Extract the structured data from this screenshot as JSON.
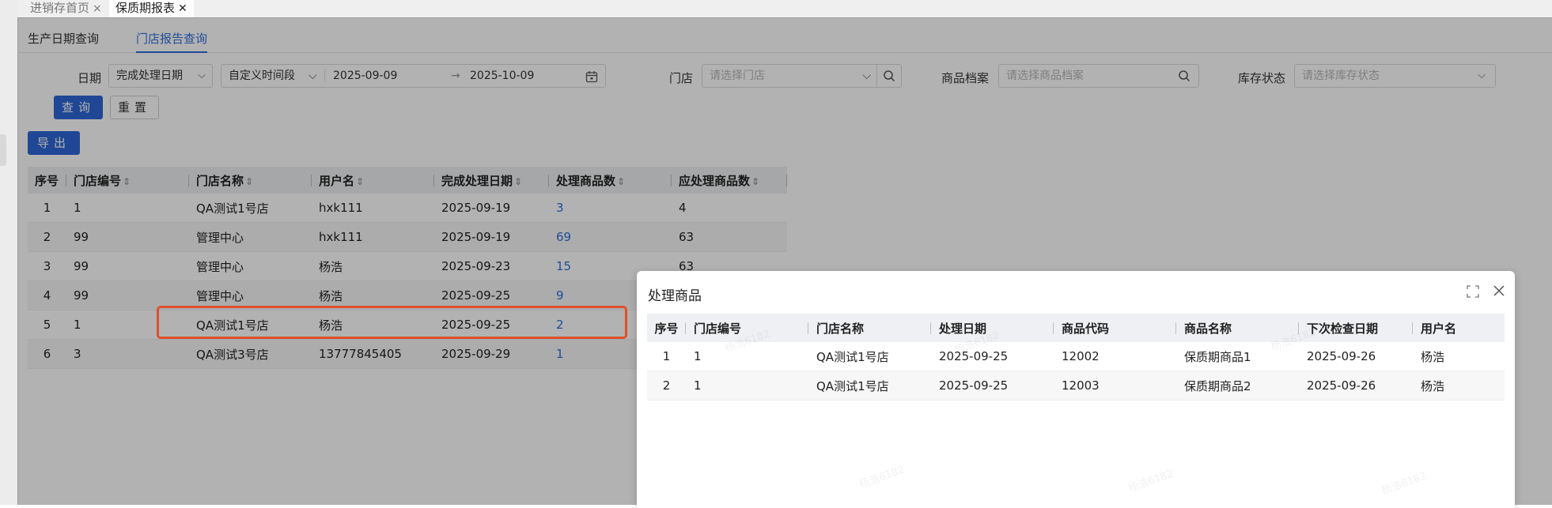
{
  "tabs": [
    {
      "label": "进销存首页",
      "close": "×"
    },
    {
      "label": "保质期报表",
      "close": "✕"
    }
  ],
  "subtabs": [
    "生产日期查询",
    "门店报告查询"
  ],
  "filters": {
    "date_label": "日期",
    "date_type": "完成处理日期",
    "range_type": "自定义时间段",
    "start_date": "2025-09-09",
    "arrow": "→",
    "end_date": "2025-10-09",
    "store_label": "门店",
    "store_placeholder": "请选择门店",
    "product_label": "商品档案",
    "product_placeholder": "请选择商品档案",
    "stock_label": "库存状态",
    "stock_placeholder": "请选择库存状态"
  },
  "buttons": {
    "query": "查询",
    "reset": "重置",
    "export": "导出"
  },
  "main_table": {
    "headers": [
      "序号",
      "门店编号",
      "门店名称",
      "用户名",
      "完成处理日期",
      "处理商品数",
      "应处理商品数"
    ],
    "sort_glyph": "⇕",
    "rows": [
      {
        "no": "1",
        "code": "1",
        "store": "QA测试1号店",
        "user": "hxk111",
        "date": "2025-09-19",
        "processed": "3",
        "expected": "4"
      },
      {
        "no": "2",
        "code": "99",
        "store": "管理中心",
        "user": "hxk111",
        "date": "2025-09-19",
        "processed": "69",
        "expected": "63"
      },
      {
        "no": "3",
        "code": "99",
        "store": "管理中心",
        "user": "杨浩",
        "date": "2025-09-23",
        "processed": "15",
        "expected": "63"
      },
      {
        "no": "4",
        "code": "99",
        "store": "管理中心",
        "user": "杨浩",
        "date": "2025-09-25",
        "processed": "9",
        "expected": ""
      },
      {
        "no": "5",
        "code": "1",
        "store": "QA测试1号店",
        "user": "杨浩",
        "date": "2025-09-25",
        "processed": "2",
        "expected": ""
      },
      {
        "no": "6",
        "code": "3",
        "store": "QA测试3号店",
        "user": "13777845405",
        "date": "2025-09-29",
        "processed": "1",
        "expected": ""
      }
    ]
  },
  "modal": {
    "title": "处理商品",
    "headers": [
      "序号",
      "门店编号",
      "门店名称",
      "处理日期",
      "商品代码",
      "商品名称",
      "下次检查日期",
      "用户名"
    ],
    "rows": [
      {
        "no": "1",
        "code": "1",
        "store": "QA测试1号店",
        "date": "2025-09-25",
        "sku": "12002",
        "name": "保质期商品1",
        "next": "2025-09-26",
        "user": "杨浩"
      },
      {
        "no": "2",
        "code": "1",
        "store": "QA测试1号店",
        "date": "2025-09-25",
        "sku": "12003",
        "name": "保质期商品2",
        "next": "2025-09-26",
        "user": "杨浩"
      }
    ],
    "watermark": "杨浩6182"
  },
  "colors": {
    "accent": "#2f6fdb",
    "button": "#2e66d6",
    "highlight": "#e0502b"
  }
}
